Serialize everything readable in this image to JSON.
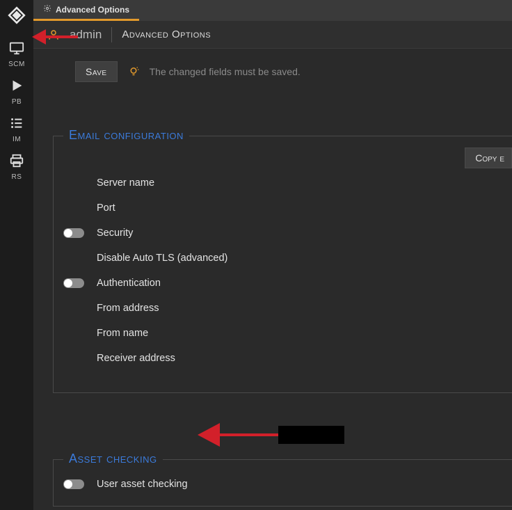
{
  "sidebar": {
    "items": [
      {
        "label": "SCM",
        "icon": "monitor-icon"
      },
      {
        "label": "PB",
        "icon": "play-icon"
      },
      {
        "label": "IM",
        "icon": "list-icon"
      },
      {
        "label": "RS",
        "icon": "print-icon"
      }
    ]
  },
  "tab": {
    "label": "Advanced Options"
  },
  "breadcrumb": {
    "user": "admin",
    "title": "Advanced Options"
  },
  "toolbar": {
    "save_label": "Save",
    "save_message": "The changed fields must be saved."
  },
  "sections": {
    "email": {
      "legend": "Email configuration",
      "copy_label": "Copy e",
      "fields": {
        "server_name": "Server name",
        "port": "Port",
        "security": "Security",
        "disable_auto_tls": "Disable Auto TLS (advanced)",
        "authentication": "Authentication",
        "from_address": "From address",
        "from_name": "From name",
        "receiver_address": "Receiver address"
      }
    },
    "asset": {
      "legend": "Asset checking",
      "fields": {
        "user_asset_checking": "User asset checking"
      }
    }
  }
}
